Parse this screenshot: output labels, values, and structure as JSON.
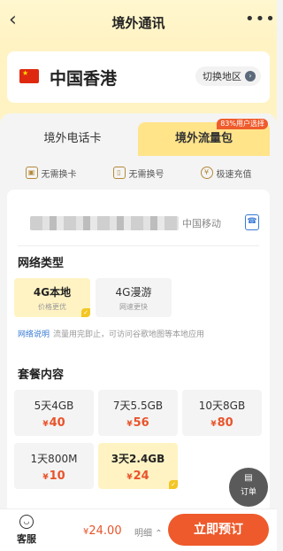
{
  "header": {
    "back_icon": "‹",
    "title": "境外通讯",
    "more_icon": "•••"
  },
  "region": {
    "flag": "cn-flag",
    "name": "中国香港",
    "switch_label": "切换地区",
    "switch_arrow": "›"
  },
  "tabs": {
    "left": "境外电话卡",
    "right": "境外流量包",
    "right_badge": "83%用户选择"
  },
  "features": [
    {
      "icon": "sim-card-icon",
      "label": "无需换卡"
    },
    {
      "icon": "phone-number-icon",
      "label": "无需换号"
    },
    {
      "icon": "recharge-icon",
      "label": "极速充值"
    }
  ],
  "phone": {
    "carrier": "中国移动"
  },
  "network": {
    "title": "网络类型",
    "options": [
      {
        "name": "4G本地",
        "sub": "价格更优",
        "selected": true
      },
      {
        "name": "4G漫游",
        "sub": "网速更快",
        "selected": false
      }
    ],
    "note_link": "网络说明",
    "note_text": "流量用完即止，可访问谷歌地图等本地应用"
  },
  "packages": {
    "title": "套餐内容",
    "currency": "¥",
    "items": [
      {
        "name": "5天4GB",
        "price": "40",
        "selected": false
      },
      {
        "name": "7天5.5GB",
        "price": "56",
        "selected": false
      },
      {
        "name": "10天8GB",
        "price": "80",
        "selected": false
      },
      {
        "name": "1天800M",
        "price": "10",
        "selected": false
      },
      {
        "name": "3天2.4GB",
        "price": "24",
        "selected": true
      }
    ]
  },
  "float_order": {
    "label": "订单"
  },
  "bottom": {
    "service_label": "客服",
    "currency": "¥",
    "total": "24.00",
    "detail_label": "明细",
    "detail_arrow": "⌃",
    "order_button": "立即预订"
  },
  "colors": {
    "accent": "#ee5a2b",
    "highlight": "#fff3c4",
    "tab_active": "#ffe48a",
    "link": "#3a7bd5"
  }
}
